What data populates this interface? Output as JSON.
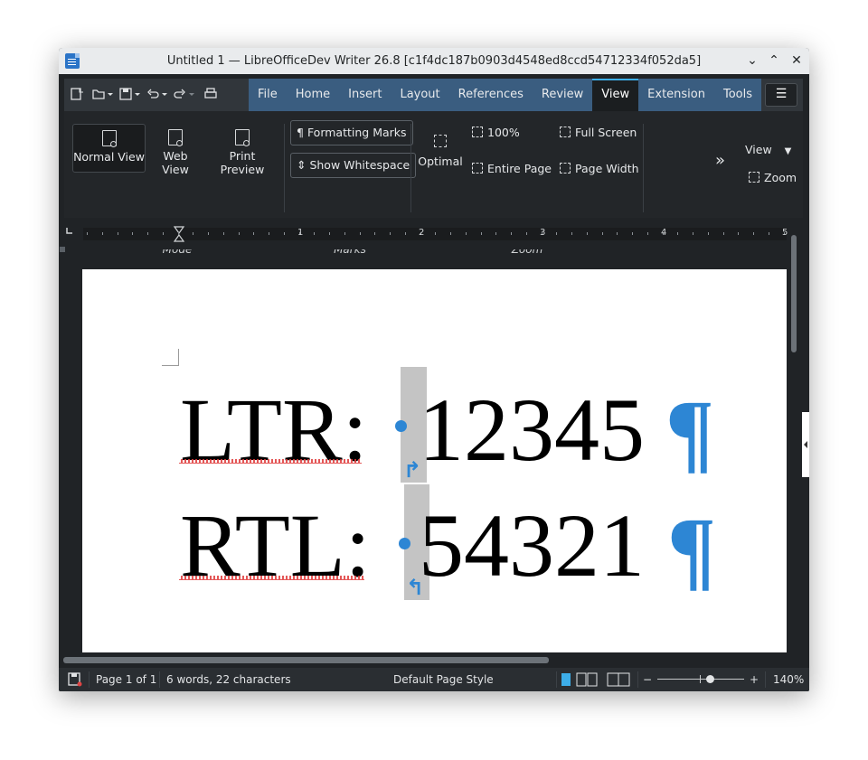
{
  "window": {
    "title": "Untitled 1 — LibreOfficeDev Writer 26.8 [c1f4dc187b0903d4548ed8ccd54712334f052da5]",
    "controls": {
      "minimize": "⌄",
      "maximize": "⌃",
      "close": "✕"
    }
  },
  "menubar": {
    "tabs": [
      {
        "label": "File"
      },
      {
        "label": "Home"
      },
      {
        "label": "Insert"
      },
      {
        "label": "Layout"
      },
      {
        "label": "References"
      },
      {
        "label": "Review"
      },
      {
        "label": "View",
        "active": true
      },
      {
        "label": "Extension"
      },
      {
        "label": "Tools"
      }
    ],
    "menu_icon": "☰"
  },
  "ribbon": {
    "mode": {
      "label": "Mode",
      "normal_view": "Normal View",
      "web_view": "Web View",
      "print_preview": "Print Preview"
    },
    "marks": {
      "label": "Marks",
      "formatting_marks": "Formatting Marks",
      "show_whitespace": "Show Whitespace"
    },
    "zoom": {
      "label": "Zoom",
      "optimal": "Optimal",
      "hundred": "100%",
      "entire_page": "Entire Page",
      "full_screen": "Full Screen",
      "page_width": "Page Width"
    },
    "more": "»",
    "view_dropdown": "View",
    "zoom_button": "Zoom"
  },
  "ruler": {
    "numbers": [
      "1",
      "2",
      "3",
      "4",
      "5"
    ]
  },
  "document": {
    "line1": {
      "label": "LTR:",
      "number": "12345",
      "pilcrow": "¶",
      "arrow": "↱"
    },
    "line2": {
      "label": "RTL:",
      "number": "54321",
      "pilcrow": "¶",
      "arrow": "↰"
    }
  },
  "statusbar": {
    "page": "Page 1 of 1",
    "words": "6 words, 22 characters",
    "page_style": "Default Page Style",
    "zoom_minus": "−",
    "zoom_plus": "+",
    "zoom_level": "140%",
    "zoom_slider_value": 0.6
  },
  "colors": {
    "accent": "#3daee9",
    "formatting_marks": "#2d86d4",
    "tab_bg": "#3a5d80",
    "spellcheck": "#e03a3a"
  }
}
